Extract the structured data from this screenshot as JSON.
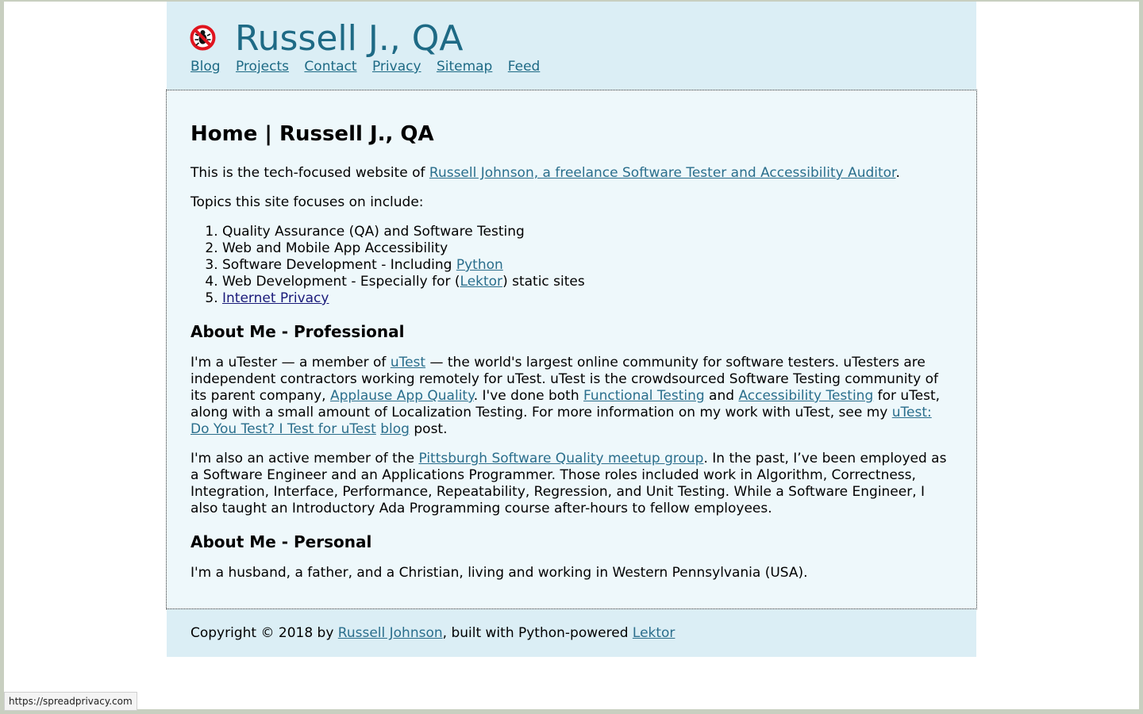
{
  "header": {
    "title": "Russell J., QA",
    "nav": [
      "Blog",
      "Projects",
      "Contact",
      "Privacy",
      "Sitemap",
      "Feed"
    ]
  },
  "main": {
    "heading": "Home | Russell J., QA",
    "intro_pre": "This is the tech-focused website of ",
    "intro_link": "Russell Johnson, a freelance Software Tester and Accessibility Auditor",
    "intro_post": ".",
    "topics_intro": "Topics this site focuses on include:",
    "topics": {
      "t1": "Quality Assurance (QA) and Software Testing",
      "t2": "Web and Mobile App Accessibility",
      "t3_pre": "Software Development - Including ",
      "t3_link": "Python",
      "t4_pre": "Web Development - Especially for (",
      "t4_link": "Lektor",
      "t4_post": ") static sites",
      "t5_link": "Internet Privacy"
    },
    "prof_heading": "About Me - Professional",
    "prof_p1": {
      "a": "I'm a uTester — a member of ",
      "l1": "uTest",
      "b": " — the world's largest online community for software testers. uTesters are independent contractors working remotely for uTest. uTest is the crowdsourced Software Testing community of its parent company, ",
      "l2": "Applause App Quality",
      "c": ". I've done both ",
      "l3": "Functional Testing",
      "d": " and ",
      "l4": "Accessibility Testing",
      "e": " for uTest, along with a small amount of Localization Testing. For more information on my work with uTest, see my ",
      "l5": "uTest: Do You Test? I Test for uTest",
      "f": " ",
      "l6": "blog",
      "g": " post."
    },
    "prof_p2": {
      "a": "I'm also an active member of the ",
      "l1": "Pittsburgh Software Quality meetup group",
      "b": ". In the past, I’ve been employed as a Software Engineer and an Applications Programmer. Those roles included work in Algorithm, Correctness, Integration, Interface, Performance, Repeatability, Regression, and Unit Testing. While a Software Engineer, I also taught an Introductory Ada Programming course after-hours to fellow employees."
    },
    "personal_heading": "About Me - Personal",
    "personal_text": "I'm a husband, a father, and a Christian, living and working in Western Pennsylvania (USA)."
  },
  "footer": {
    "pre": "Copyright © 2018 by ",
    "link1": "Russell Johnson",
    "mid": ", built with Python-powered ",
    "link2": "Lektor"
  },
  "status_bar": "https://spreadprivacy.com",
  "colors": {
    "header_bg": "#dbeef5",
    "main_bg": "#eef8fb",
    "link": "#2a6e8c",
    "title": "#1e6a85",
    "logo_red": "#e0141e"
  },
  "icons": {
    "logo": "no-bug-icon"
  }
}
